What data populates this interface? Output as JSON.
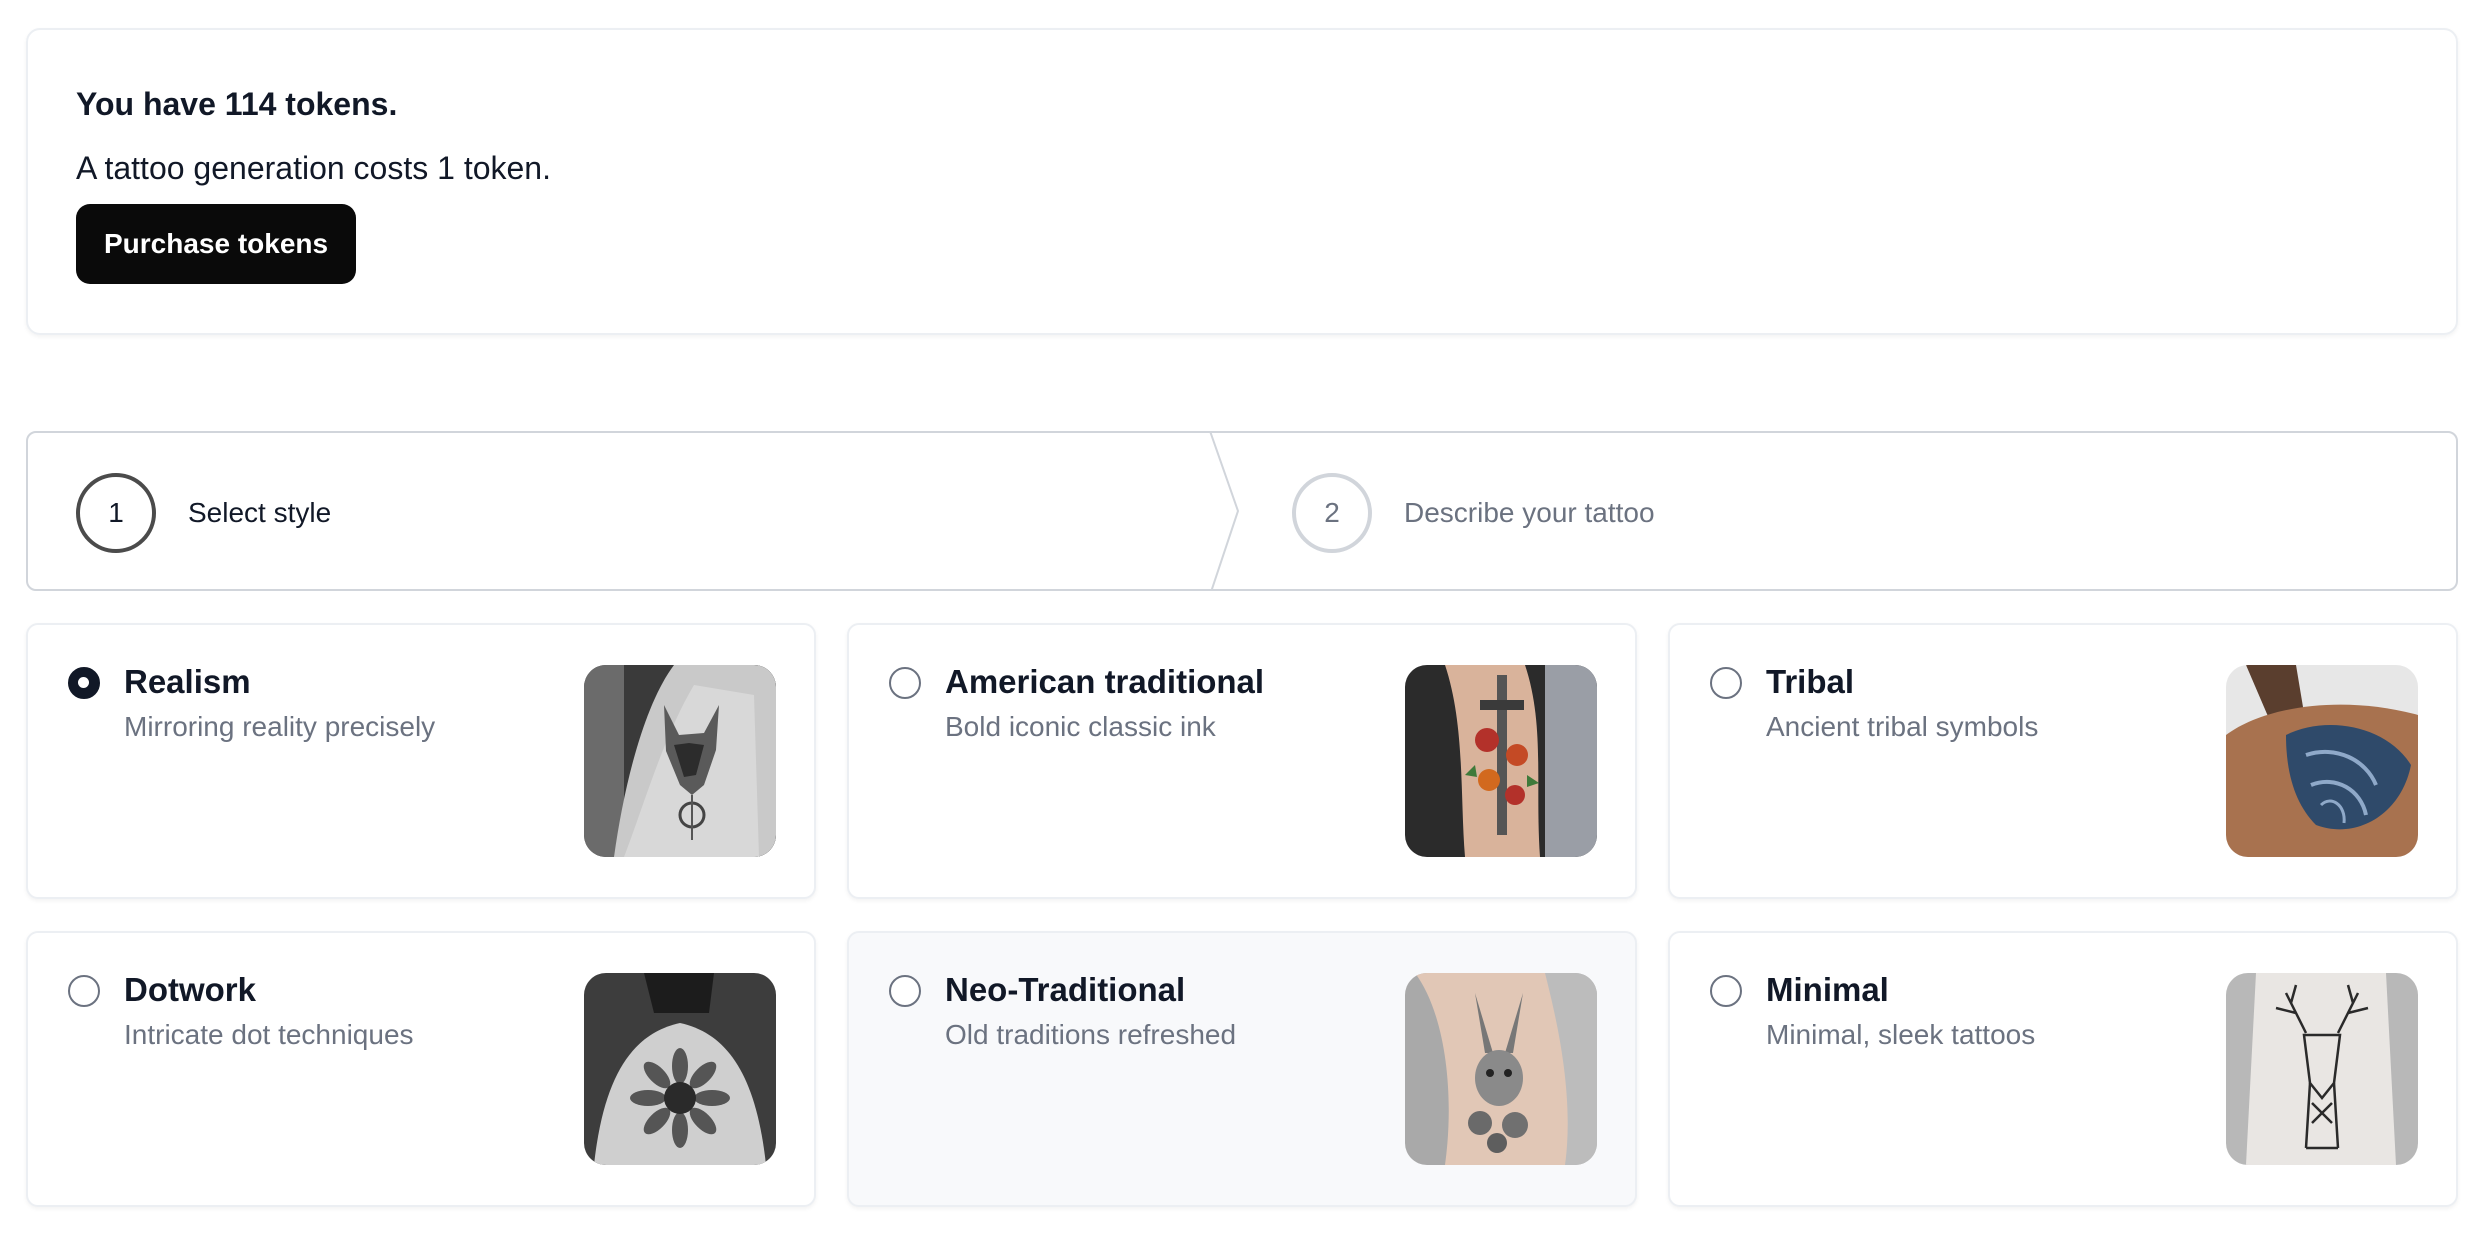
{
  "tokens": {
    "title": "You have 114 tokens.",
    "cost_text": "A tattoo generation costs 1 token.",
    "purchase_label": "Purchase tokens"
  },
  "stepper": {
    "steps": [
      {
        "number": "1",
        "label": "Select style",
        "state": "current"
      },
      {
        "number": "2",
        "label": "Describe your tattoo",
        "state": "upcoming"
      }
    ]
  },
  "styles": [
    {
      "title": "Realism",
      "description": "Mirroring reality precisely",
      "selected": true,
      "image": "wolf-tattoo-on-forearm"
    },
    {
      "title": "American traditional",
      "description": "Bold iconic classic ink",
      "selected": false,
      "image": "dagger-and-roses-tattoo"
    },
    {
      "title": "Tribal",
      "description": "Ancient tribal symbols",
      "selected": false,
      "image": "tribal-lion-shoulder-tattoo"
    },
    {
      "title": "Dotwork",
      "description": "Intricate dot techniques",
      "selected": false,
      "image": "sunflower-back-tattoo"
    },
    {
      "title": "Neo-Traditional",
      "description": "Old traditions refreshed",
      "selected": false,
      "image": "rabbit-floral-arm-tattoo"
    },
    {
      "title": "Minimal",
      "description": "Minimal, sleek tattoos",
      "selected": false,
      "image": "line-deer-forearm-tattoo"
    }
  ],
  "colors": {
    "button_bg": "#0a0a0a",
    "selected_radio": "#111827",
    "muted_text": "#6b7280",
    "hover_card_bg": "#f8f9fb"
  }
}
